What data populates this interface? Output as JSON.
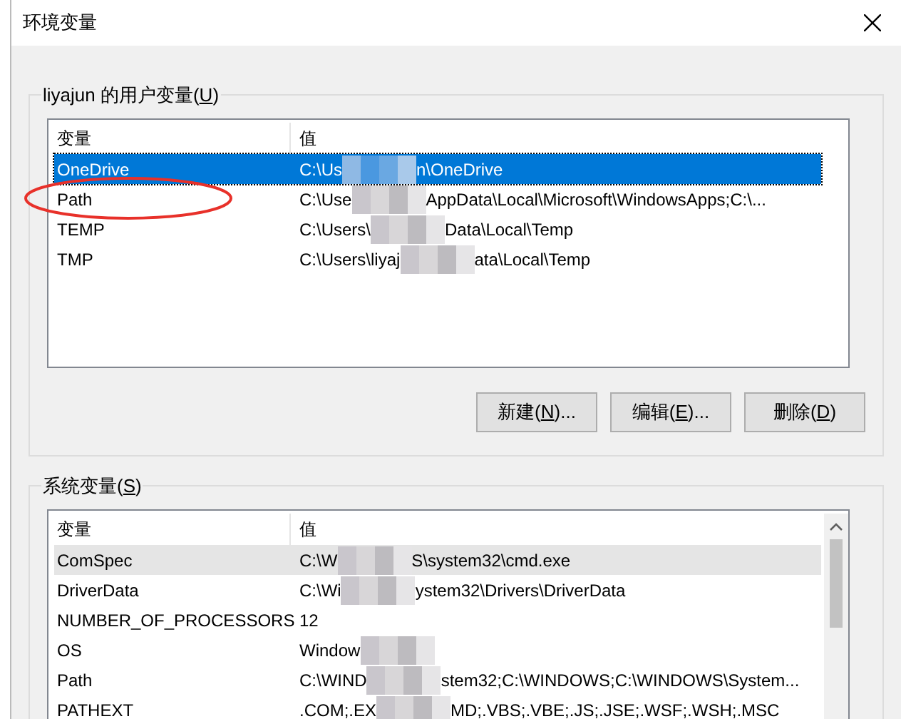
{
  "window": {
    "title": "环境变量"
  },
  "user_variables": {
    "label": {
      "text": "liyajun 的用户变量(",
      "key": "U",
      "close": ")"
    },
    "columns": [
      "变量",
      "值"
    ],
    "rows": [
      {
        "name": "OneDrive",
        "value": [
          "C:\\Us",
          "n\\OneDrive"
        ],
        "selected": true
      },
      {
        "name": "Path",
        "value": [
          "C:\\Use",
          "AppData\\Local\\Microsoft\\WindowsApps;C:\\..."
        ],
        "selected": false
      },
      {
        "name": "TEMP",
        "value": [
          "C:\\Users\\",
          "Data\\Local\\Temp"
        ],
        "selected": false
      },
      {
        "name": "TMP",
        "value": [
          "C:\\Users\\liyaj",
          "ata\\Local\\Temp"
        ],
        "selected": false
      }
    ]
  },
  "buttons": [
    {
      "text": "新建(",
      "key": "N",
      "close": ")..."
    },
    {
      "text": "编辑(",
      "key": "E",
      "close": ")..."
    },
    {
      "text": "删除(",
      "key": "D",
      "close": ")"
    }
  ],
  "system_variables": {
    "label": {
      "text": "系统变量(",
      "key": "S",
      "close": ")"
    },
    "columns": [
      "变量",
      "值"
    ],
    "rows": [
      {
        "name": "ComSpec",
        "value": [
          "C:\\W",
          "S\\system32\\cmd.exe"
        ],
        "highlighted": true
      },
      {
        "name": "DriverData",
        "value": [
          "C:\\Wi",
          "ystem32\\Drivers\\DriverData"
        ],
        "highlighted": false
      },
      {
        "name": "NUMBER_OF_PROCESSORS",
        "value": [
          "12"
        ],
        "highlighted": false
      },
      {
        "name": "OS",
        "value": [
          "Window"
        ],
        "highlighted": false
      },
      {
        "name": "Path",
        "value": [
          "C:\\WIND",
          "stem32;C:\\WINDOWS;C:\\WINDOWS\\System..."
        ],
        "highlighted": false
      },
      {
        "name": "PATHEXT",
        "value": [
          ".COM;.EX",
          "MD;.VBS;.VBE;.JS;.JSE;.WSF;.WSH;.MSC"
        ],
        "highlighted": false
      }
    ]
  }
}
